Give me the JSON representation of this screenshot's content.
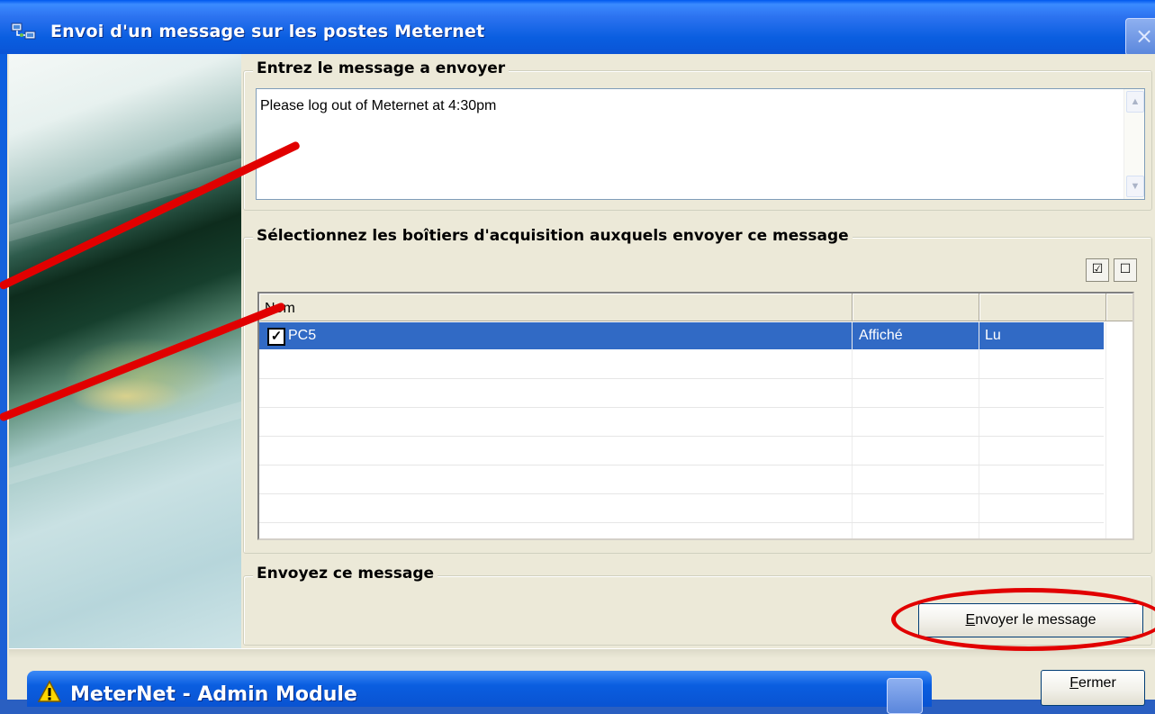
{
  "window": {
    "title": "Envoi d'un message sur les postes Meternet",
    "close_label": "×"
  },
  "message_group": {
    "legend": "Entrez le message a envoyer",
    "message_value": "Please log out of Meternet at 4:30pm"
  },
  "select_group": {
    "legend": "Sélectionnez les boîtiers d'acquisition auxquels envoyer ce message",
    "check_all_label": "☑",
    "uncheck_all_label": "☐",
    "columns": [
      "Nom",
      "",
      ""
    ],
    "rows": [
      {
        "checked": true,
        "check_mark": "✓",
        "name": "PC5",
        "displayed": "Affiché",
        "read": "Lu"
      }
    ]
  },
  "send_group": {
    "legend": "Envoyez ce message",
    "send_button_accel": "E",
    "send_button_rest": "nvoyer le message"
  },
  "footer": {
    "close_accel": "F",
    "close_rest": "ermer"
  },
  "background_dialog": {
    "title": "MeterNet - Admin Module"
  },
  "colors": {
    "title_bar": "#0a5ee0",
    "selection": "#316ac5",
    "annotation_red": "#e10000",
    "dialog_face": "#ece9d8"
  }
}
